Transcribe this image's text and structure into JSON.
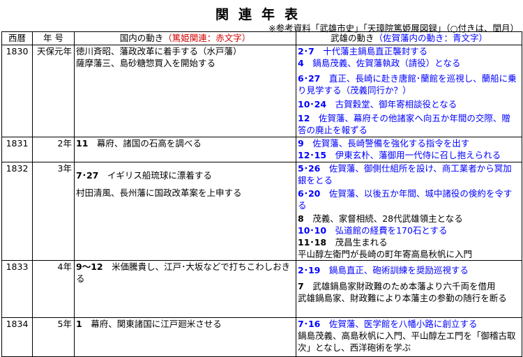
{
  "title": "関連年表",
  "note": "※参考資料「武雄市史」「天璋院篤姫展図録」（○付きは、閏月）",
  "headers": {
    "year": "西暦",
    "era": "年 号",
    "domestic": "国内の動き",
    "domestic_note": "（篤姫関連：赤文字）",
    "takeo": "武雄の動き",
    "takeo_note": "（佐賀藩内の動き：青文字）"
  },
  "rows": [
    {
      "year": "1830",
      "era": "天保元年",
      "domestic": [
        {
          "date": "",
          "text": "徳川斉昭、藩政改革に着手する（水戸藩）"
        },
        {
          "date": "",
          "text": "薩摩藩三、島砂糖惣買入を開始する"
        }
      ],
      "takeo": [
        {
          "date": "2･7",
          "text": "十代藩主鍋島直正襲封する",
          "blue": true
        },
        {
          "date": "4",
          "text": "鍋島茂義、佐賀藩執政（請役）となる",
          "blue": true
        },
        {
          "date": "6･27",
          "text": "直正、長崎に赴き唐館･蘭館を巡視し、蘭船に乗り見学する（茂義同行か？）",
          "blue": true
        },
        {
          "date": "10･24",
          "text": "古賀穀堂、御年寄相談役となる",
          "blue": true
        },
        {
          "date": "12",
          "text": "佐賀藩、幕府その他諸家へ向五か年間の交際、贈答の廃止を報ずる",
          "blue": true
        }
      ]
    },
    {
      "year": "1831",
      "era": "2年",
      "domestic": [
        {
          "date": "11",
          "text": "幕府、諸国の石高を調べる"
        }
      ],
      "takeo": [
        {
          "date": "9",
          "text": "佐賀藩、長崎警備を強化する指令を出す",
          "blue": true
        },
        {
          "date": "12･15",
          "text": "伊東玄朴、藩御用一代侍に召し抱えられる",
          "blue": true
        }
      ]
    },
    {
      "year": "1832",
      "era": "3年",
      "domestic": [
        {
          "date": "7･27",
          "text": "イギリス船琉球に漂着する"
        },
        {
          "date": "",
          "text": "村田清風、長州藩に国政改革案を上申する"
        }
      ],
      "takeo": [
        {
          "date": "5･26",
          "text": "佐賀藩、御側仕組所を設け、商工業者から冥加銀をとる",
          "blue": true
        },
        {
          "date": "6･20",
          "text": "佐賀藩、以後五か年間、城中諸役の倹約を令する",
          "blue": true
        },
        {
          "date": "8",
          "text": "茂義、家督相続、28代武雄領主となる",
          "blue": false
        },
        {
          "date": "10･10",
          "text": "弘道館の経費を170石とする",
          "blue": true
        },
        {
          "date": "11･18",
          "text": "茂昌生まれる",
          "blue": false
        },
        {
          "date": "",
          "text": "平山醇左衛門が長崎の町年寄高島秋帆に入門",
          "blue": false
        }
      ]
    },
    {
      "year": "1833",
      "era": "4年",
      "domestic": [
        {
          "date": "9～12",
          "text": "米価騰貴し、江戸･大坂などで打ちこわしおきる"
        }
      ],
      "takeo": [
        {
          "date": "2･19",
          "text": "鍋島直正、砲術訓練を奨励巡視する",
          "blue": true
        },
        {
          "date": "7",
          "text": "武雄鍋島家財政難のため本藩より六千両を借用",
          "blue": false
        },
        {
          "date": "",
          "text": "武雄鍋島家、財政難により本藩主の参勤の随行を断る",
          "blue": false
        }
      ]
    },
    {
      "year": "1834",
      "era": "5年",
      "domestic": [
        {
          "date": "1",
          "text": "幕府、関東諸国に江戸廻米させる"
        }
      ],
      "takeo": [
        {
          "date": "7･16",
          "text": "佐賀藩、医学館を八幡小路に創立する",
          "blue": true
        },
        {
          "date": "",
          "text": "鍋島茂義、高島秋帆に入門、平山醇左エ門を「御稽古取次」となし、西洋砲術を学ぶ",
          "blue": false
        }
      ]
    }
  ]
}
